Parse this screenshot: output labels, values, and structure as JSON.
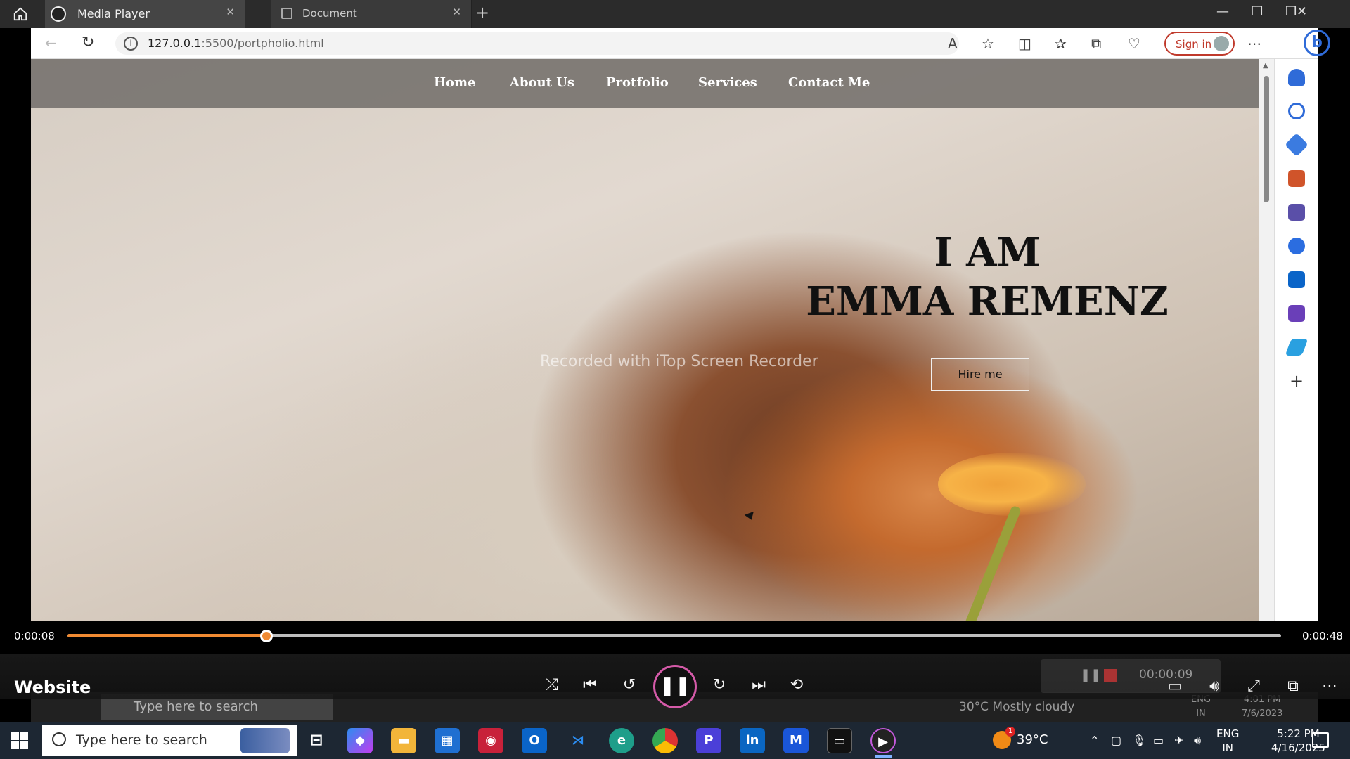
{
  "media_player": {
    "app_name": "Media Player",
    "media_title": "Website",
    "elapsed": "0:00:08",
    "duration": "0:00:48",
    "progress_fraction": 0.164,
    "accent_color": "#f08a32"
  },
  "browser": {
    "tabs": [
      {
        "label": "Document"
      },
      {
        "label": "Document"
      }
    ],
    "url_host": "127.0.0.1",
    "url_rest": ":5500/portpholio.html",
    "sign_in_label": "Sign in"
  },
  "site": {
    "nav": [
      "Home",
      "About Us",
      "Protfolio",
      "Services",
      "Contact Me"
    ],
    "hero_line1": "I AM",
    "hero_line2": "EMMA REMENZ",
    "hire_button": "Hire me"
  },
  "watermark": "Recorded with iTop Screen Recorder",
  "recorder": {
    "time": "00:00:09"
  },
  "ghost_taskbar": {
    "search_placeholder": "Type here to search",
    "weather": "30°C  Mostly cloudy",
    "lang1": "ENG",
    "lang2": "IN",
    "time": "4:01 PM",
    "date": "7/6/2023"
  },
  "taskbar": {
    "search_placeholder": "Type here to search",
    "temperature": "39°C",
    "weather_badge": "1",
    "lang1": "ENG",
    "lang2": "IN",
    "time": "5:22 PM",
    "date": "4/16/2025"
  }
}
